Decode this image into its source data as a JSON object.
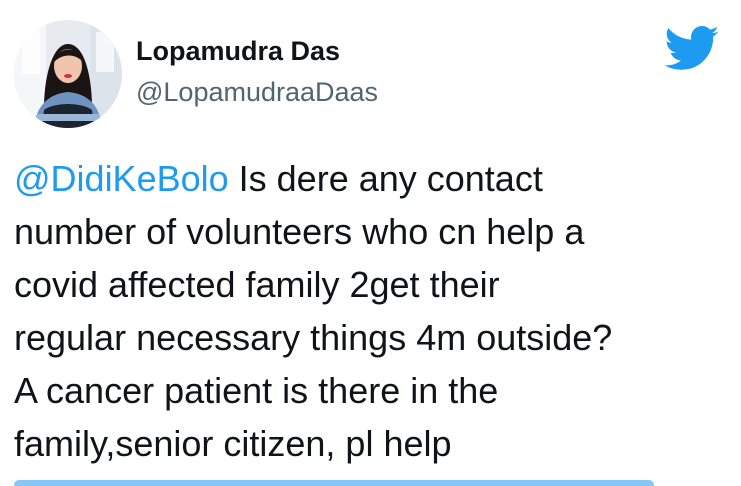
{
  "author": {
    "display_name": "Lopamudra Das",
    "handle": "@LopamudraaDaas"
  },
  "tweet": {
    "mention": "@DidiKeBolo",
    "first_line_rest": " Is dere any contact",
    "lines": [
      "number of volunteers who cn help a",
      "covid affected family 2get their",
      "regular necessary things 4m outside?",
      "A cancer patient is there in the",
      "family,senior citizen, pl help"
    ]
  },
  "icons": {
    "brand_logo": "twitter-bird-icon",
    "avatar": "profile-photo"
  },
  "colors": {
    "mention": "#1d9bf0",
    "twitter_blue": "#1d9bf0",
    "text": "#0f1419",
    "secondary_text": "#536471",
    "background": "#ffffff"
  }
}
